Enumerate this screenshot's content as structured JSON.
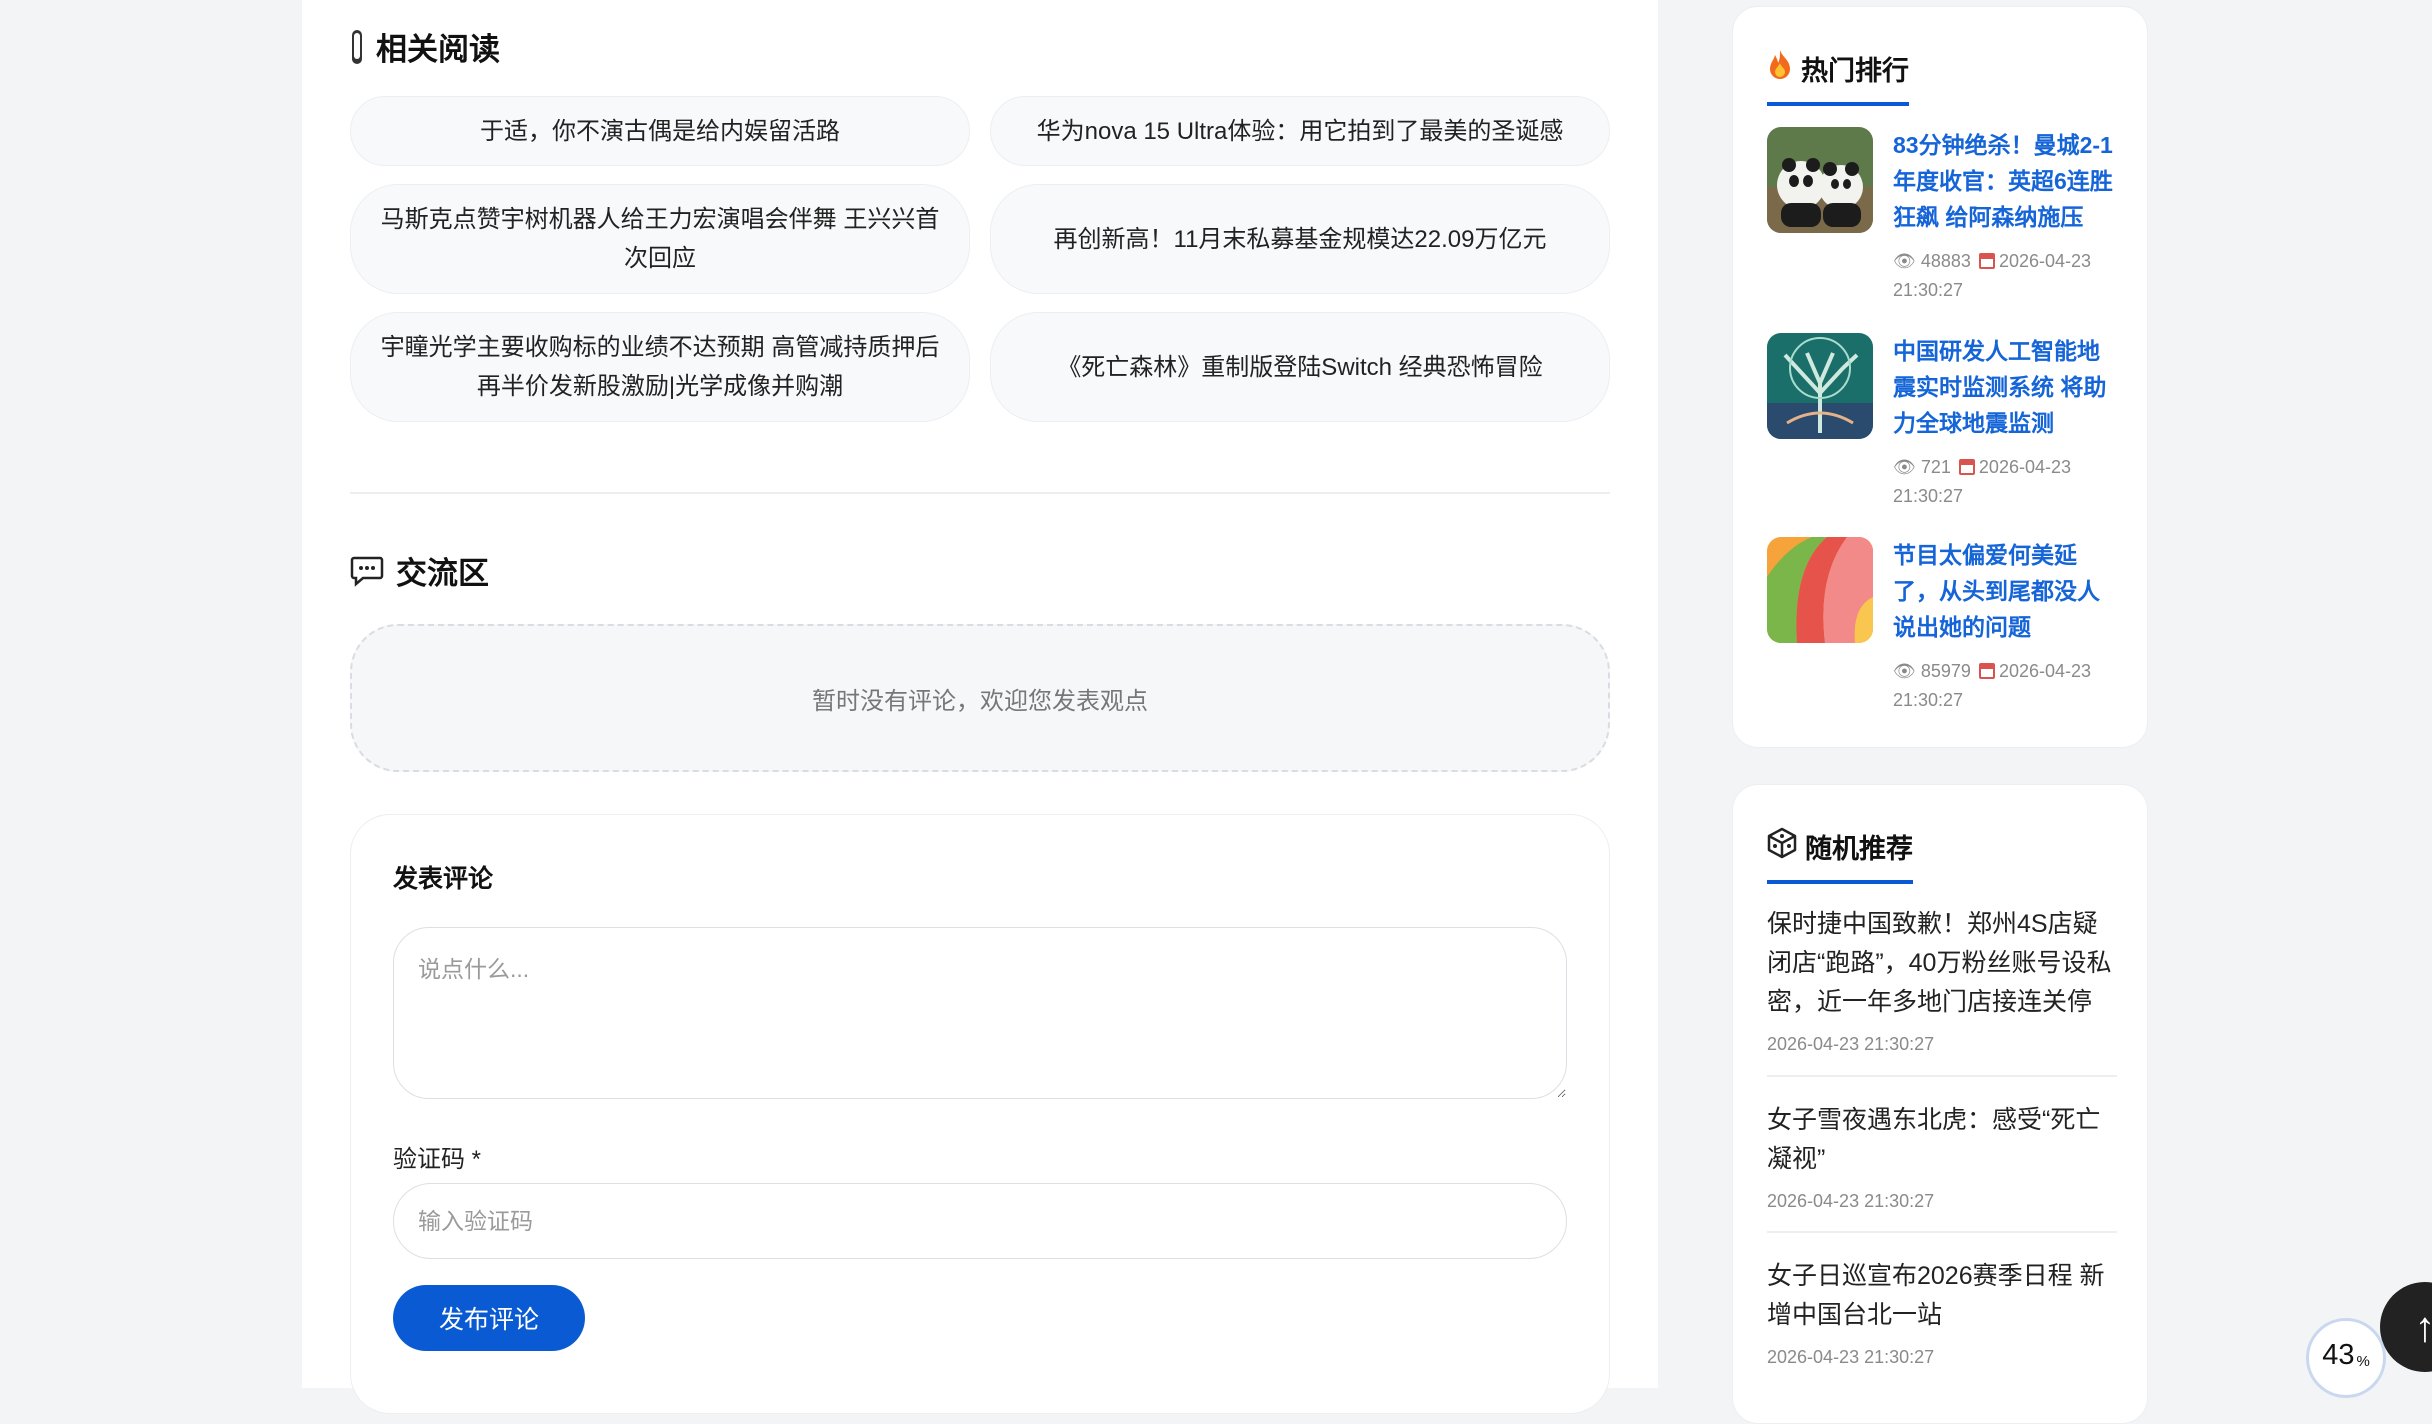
{
  "related": {
    "title": "相关阅读",
    "items": [
      "于适，你不演古偶是给内娱留活路",
      "华为nova 15 Ultra体验：用它拍到了最美的圣诞感",
      "马斯克点赞宇树机器人给王力宏演唱会伴舞 王兴兴首次回应",
      "再创新高！11月末私募基金规模达22.09万亿元",
      "宇瞳光学主要收购标的业绩不达预期 高管减持质押后再半价发新股激励|光学成像并购潮",
      "《死亡森林》重制版登陆Switch 经典恐怖冒险"
    ]
  },
  "comments": {
    "title": "交流区",
    "empty_text": "暂时没有评论，欢迎您发表观点",
    "form_title": "发表评论",
    "textarea_placeholder": "说点什么...",
    "captcha_label": "验证码 *",
    "captcha_placeholder": "输入验证码",
    "submit_label": "发布评论"
  },
  "hot": {
    "title": "热门排行",
    "items": [
      {
        "title": "83分钟绝杀！曼城2-1年度收官：英超6连胜狂飙 给阿森纳施压",
        "views": "48883",
        "date": "2026-04-23 21:30:27"
      },
      {
        "title": "中国研发人工智能地震实时监测系统 将助力全球地震监测",
        "views": "721",
        "date": "2026-04-23 21:30:27"
      },
      {
        "title": "节目太偏爱何美延了，从头到尾都没人说出她的问题",
        "views": "85979",
        "date": "2026-04-23 21:30:27"
      }
    ]
  },
  "random": {
    "title": "随机推荐",
    "items": [
      {
        "title": "保时捷中国致歉！郑州4S店疑闭店“跑路”，40万粉丝账号设私密，近一年多地门店接连关停",
        "date": "2026-04-23 21:30:27"
      },
      {
        "title": "女子雪夜遇东北虎：感受“死亡凝视”",
        "date": "2026-04-23 21:30:27"
      },
      {
        "title": "女子日巡宣布2026赛季日程 新增中国台北一站",
        "date": "2026-04-23 21:30:27"
      }
    ]
  },
  "widgets": {
    "to_top": "↑",
    "progress_value": "43",
    "progress_unit": "%"
  },
  "colors": {
    "accent": "#0a5bd3",
    "hot_link": "#1565d8"
  }
}
